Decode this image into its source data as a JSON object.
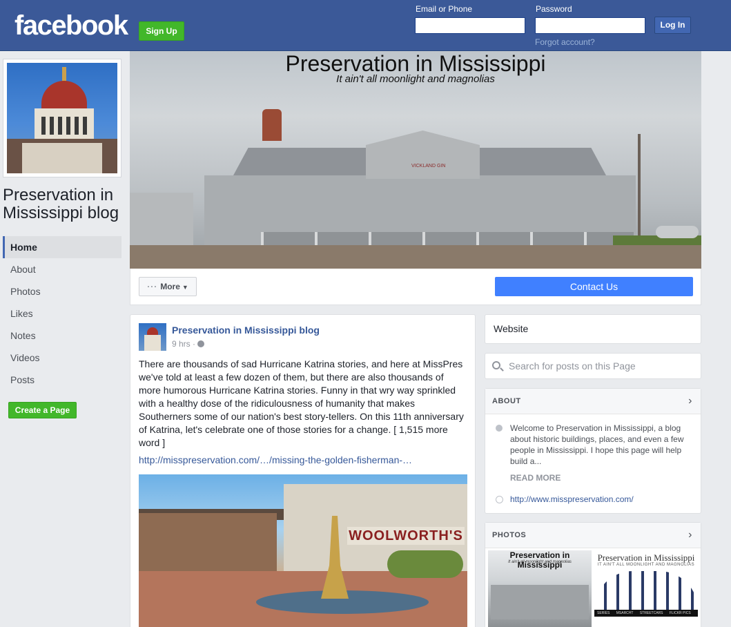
{
  "header": {
    "logo_text": "facebook",
    "signup_label": "Sign Up",
    "email_label": "Email or Phone",
    "password_label": "Password",
    "login_label": "Log In",
    "forgot_label": "Forgot account?"
  },
  "page": {
    "name": "Preservation in Mississippi blog"
  },
  "sidebar": {
    "items": [
      {
        "label": "Home",
        "active": true
      },
      {
        "label": "About"
      },
      {
        "label": "Photos"
      },
      {
        "label": "Likes"
      },
      {
        "label": "Notes"
      },
      {
        "label": "Videos"
      },
      {
        "label": "Posts"
      }
    ],
    "create_page_label": "Create a Page"
  },
  "cover": {
    "title": "Preservation in Mississippi",
    "subtitle": "It ain't all moonlight and magnolias",
    "building_sign": "VICKLAND GIN"
  },
  "cover_bar": {
    "more_label": "More",
    "contact_label": "Contact Us"
  },
  "post": {
    "author": "Preservation in Mississippi blog",
    "time": "9 hrs ·",
    "text": "There are thousands of sad Hurricane Katrina stories, and here at MissPres we've told at least a few dozen of them, but there are also thousands of more humorous Hurricane Katrina stories. Funny in that wry way sprinkled with a healthy dose of the ridiculousness of humanity that makes Southerners some of our nation's best story-tellers. On this 11th anniversary of Katrina, let's celebrate one of those stories for a change. [ 1,515 more word ]",
    "link": "http://misspreservation.com/…/missing-the-golden-fisherman-…",
    "photo_sign": "WOOLWORTH'S"
  },
  "right": {
    "website_label": "Website",
    "search_placeholder": "Search for posts on this Page",
    "about": {
      "heading": "ABOUT",
      "text": "Welcome to Preservation in Mississippi, a blog about historic buildings, places, and even a few people in Mississippi. I hope this page will help build a...",
      "read_more": "READ MORE",
      "url": "http://www.misspreservation.com/"
    },
    "photos": {
      "heading": "PHOTOS",
      "thumb1_title": "Preservation in Mississippi",
      "thumb1_sub": "It ain't all moonlight and magnolias",
      "thumb2_title": "Preservation in Mississippi",
      "thumb2_sub": "IT AIN'T ALL MOONLIGHT AND MAGNOLIAS",
      "thumb2_nav": [
        "SERIES",
        "MSARCHT",
        "STREETCARS",
        "FLICKR PICS"
      ]
    }
  },
  "colors": {
    "brand_blue": "#3b5998",
    "green": "#42b72a",
    "contact_blue": "#4080ff",
    "link": "#365899"
  }
}
